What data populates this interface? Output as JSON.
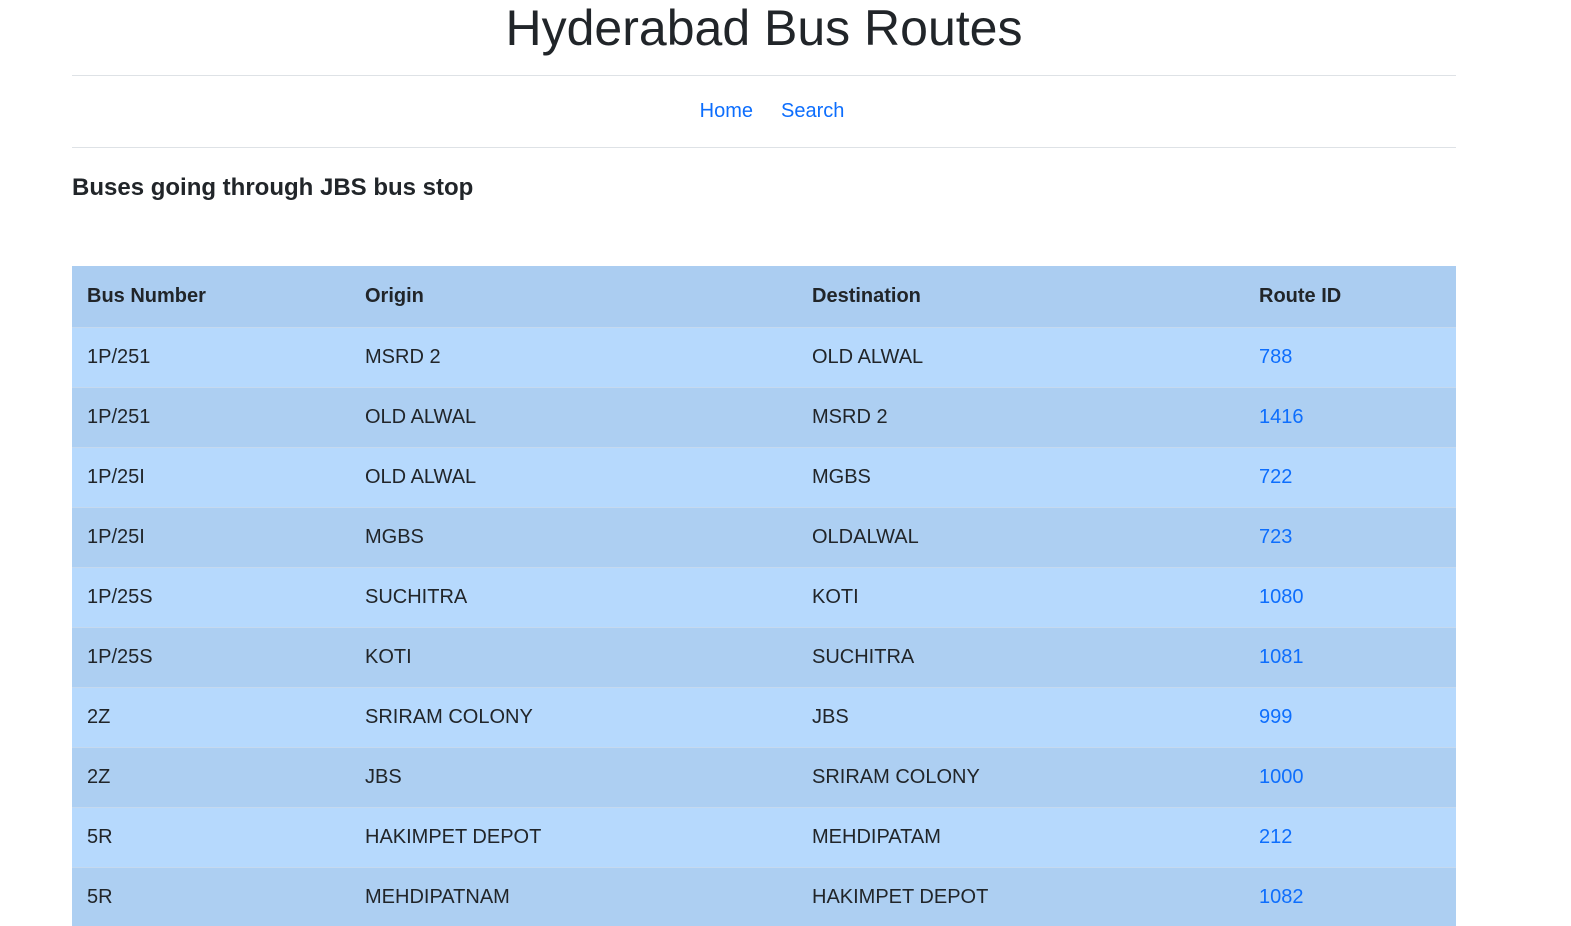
{
  "header": {
    "title": "Hyderabad Bus Routes"
  },
  "nav": {
    "items": [
      {
        "label": "Home"
      },
      {
        "label": "Search"
      }
    ]
  },
  "main": {
    "heading": "Buses going through JBS bus stop",
    "table": {
      "columns": [
        "Bus Number",
        "Origin",
        "Destination",
        "Route ID"
      ],
      "rows": [
        {
          "bus_number": "1P/251",
          "origin": "MSRD 2",
          "destination": "OLD ALWAL",
          "route_id": "788"
        },
        {
          "bus_number": "1P/251",
          "origin": "OLD ALWAL",
          "destination": "MSRD 2",
          "route_id": "1416"
        },
        {
          "bus_number": "1P/25I",
          "origin": "OLD ALWAL",
          "destination": "MGBS",
          "route_id": "722"
        },
        {
          "bus_number": "1P/25I",
          "origin": "MGBS",
          "destination": "OLDALWAL",
          "route_id": "723"
        },
        {
          "bus_number": "1P/25S",
          "origin": "SUCHITRA",
          "destination": "KOTI",
          "route_id": "1080"
        },
        {
          "bus_number": "1P/25S",
          "origin": "KOTI",
          "destination": "SUCHITRA",
          "route_id": "1081"
        },
        {
          "bus_number": "2Z",
          "origin": "SRIRAM COLONY",
          "destination": "JBS",
          "route_id": "999"
        },
        {
          "bus_number": "2Z",
          "origin": "JBS",
          "destination": "SRIRAM COLONY",
          "route_id": "1000"
        },
        {
          "bus_number": "5R",
          "origin": "HAKIMPET DEPOT",
          "destination": "MEHDIPATAM",
          "route_id": "212"
        },
        {
          "bus_number": "5R",
          "origin": "MEHDIPATNAM",
          "destination": "HAKIMPET DEPOT",
          "route_id": "1082"
        }
      ]
    }
  },
  "colors": {
    "link": "#0d6efd",
    "header_row": "#abcdf1",
    "row_light": "#b6d9fd",
    "row_dark": "#adcff2"
  }
}
